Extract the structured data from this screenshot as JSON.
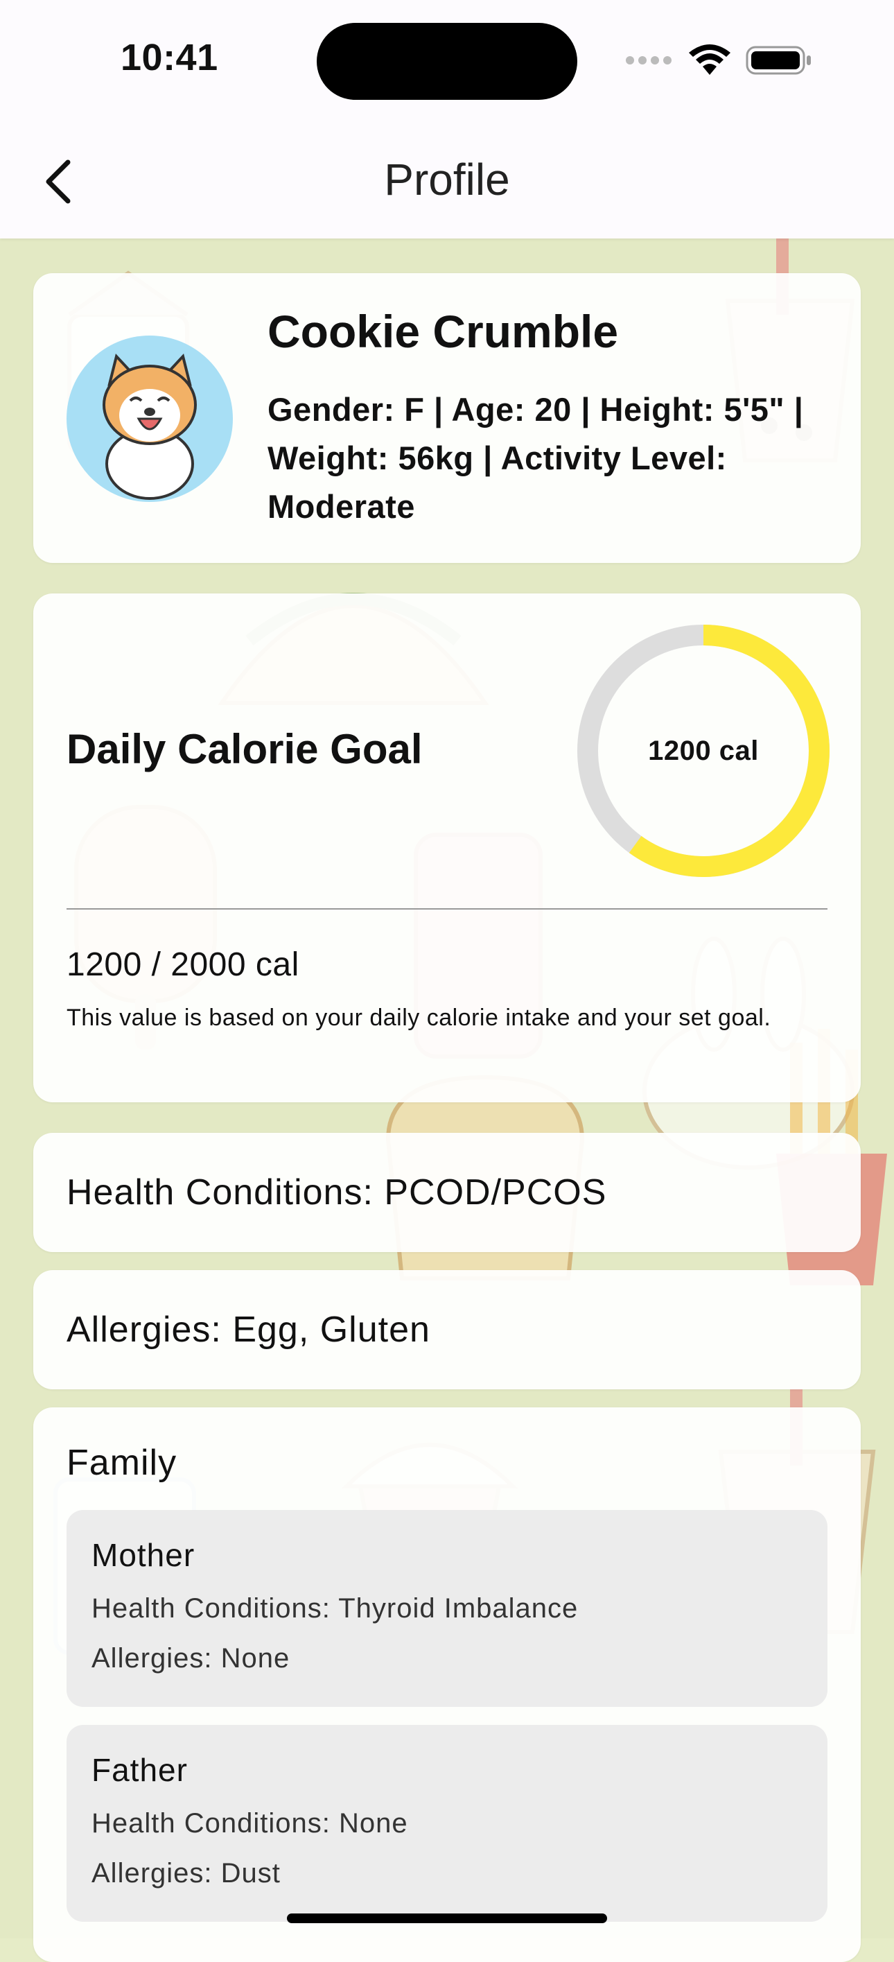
{
  "status_bar": {
    "time": "10:41"
  },
  "nav": {
    "title": "Profile"
  },
  "profile": {
    "name": "Cookie Crumble",
    "details": "Gender: F | Age: 20 | Height: 5'5\" | Weight: 56kg | Activity Level: Moderate"
  },
  "calorie_goal": {
    "title": "Daily Calorie Goal",
    "ring_label": "1200 cal",
    "value_text": "1200 / 2000 cal",
    "note": "This value is based on your daily calorie intake and your set goal.",
    "consumed": 1200,
    "goal": 2000,
    "progress_fraction": 0.6,
    "ring_color": "#fde93b",
    "track_color": "#dddddd"
  },
  "health": {
    "label": "Health Conditions: PCOD/PCOS"
  },
  "allergies": {
    "label": "Allergies: Egg, Gluten"
  },
  "family": {
    "title": "Family",
    "members": [
      {
        "name": "Mother",
        "conditions": "Health Conditions: Thyroid Imbalance",
        "allergies": "Allergies: None"
      },
      {
        "name": "Father",
        "conditions": "Health Conditions: None",
        "allergies": "Allergies: Dust"
      }
    ]
  },
  "icons": [
    "chevron-left-icon",
    "signal-icon",
    "wifi-icon",
    "battery-icon",
    "dog-avatar"
  ]
}
